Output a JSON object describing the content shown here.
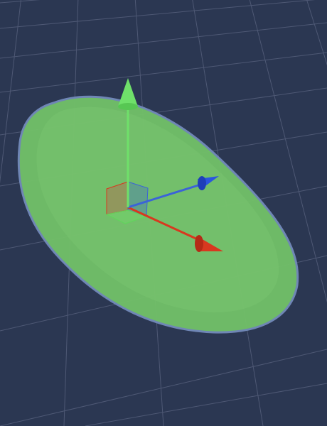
{
  "scene_view": {
    "background_color": "#2b3752",
    "grid": {
      "line_color": "#5a6480",
      "visible": true
    }
  },
  "selected_object": {
    "shape": "flat-disc",
    "fill_color": "#72c168",
    "outline_color": "#6f86b5"
  },
  "move_gizmo": {
    "axes": [
      {
        "axis": "y",
        "color": "#6fe06a",
        "icon": "arrow-up-icon"
      },
      {
        "axis": "z",
        "color": "#2a55e0",
        "icon": "cone-icon"
      },
      {
        "axis": "x",
        "color": "#d8381f",
        "icon": "cone-icon"
      }
    ],
    "center_handle": {
      "icon": "cube-icon"
    }
  }
}
